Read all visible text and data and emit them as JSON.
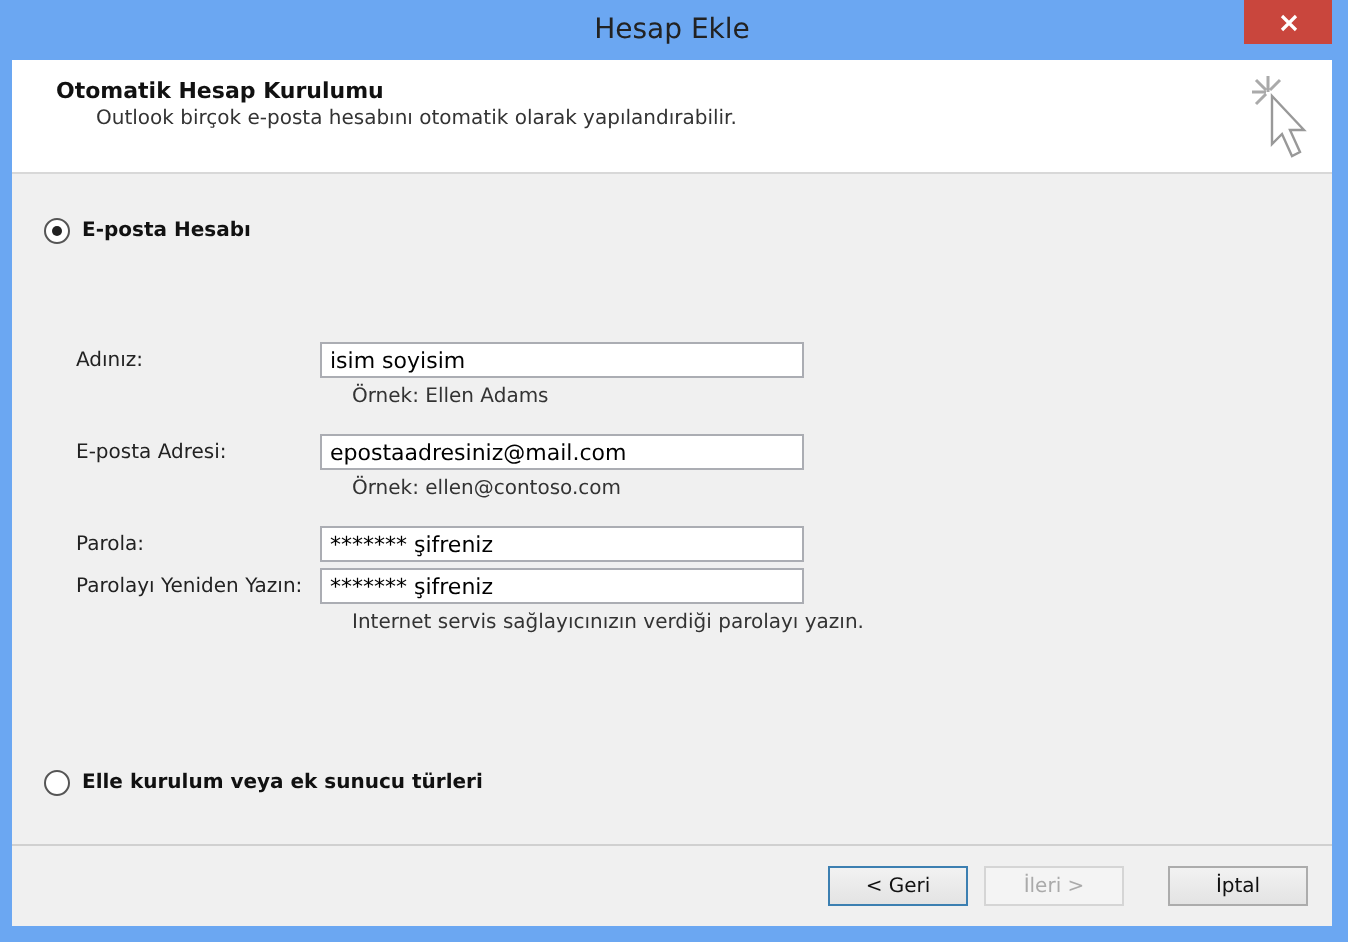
{
  "window": {
    "title": "Hesap Ekle"
  },
  "header": {
    "title": "Otomatik Hesap Kurulumu",
    "subtitle": "Outlook birçok e-posta hesabını otomatik olarak yapılandırabilir."
  },
  "options": [
    {
      "label": "E-posta Hesabı",
      "selected": true
    },
    {
      "label": "Elle kurulum veya ek sunucu türleri",
      "selected": false
    }
  ],
  "fields": [
    {
      "label": "Adınız:",
      "value": "isim soyisim",
      "hint": "Örnek: Ellen Adams"
    },
    {
      "label": "E-posta Adresi:",
      "value": "epostaadresiniz@mail.com",
      "hint": "Örnek: ellen@contoso.com"
    },
    {
      "label": "Parola:",
      "value": "******* şifreniz"
    },
    {
      "label": "Parolayı Yeniden Yazın:",
      "value": "******* şifreniz",
      "hint": "Internet servis sağlayıcınızın verdiği parolayı yazın."
    }
  ],
  "buttons": [
    {
      "label": "< Geri",
      "disabled": false,
      "focused": true
    },
    {
      "label": "İleri >",
      "disabled": true,
      "focused": false
    },
    {
      "label": "İptal",
      "disabled": false,
      "focused": false
    }
  ]
}
